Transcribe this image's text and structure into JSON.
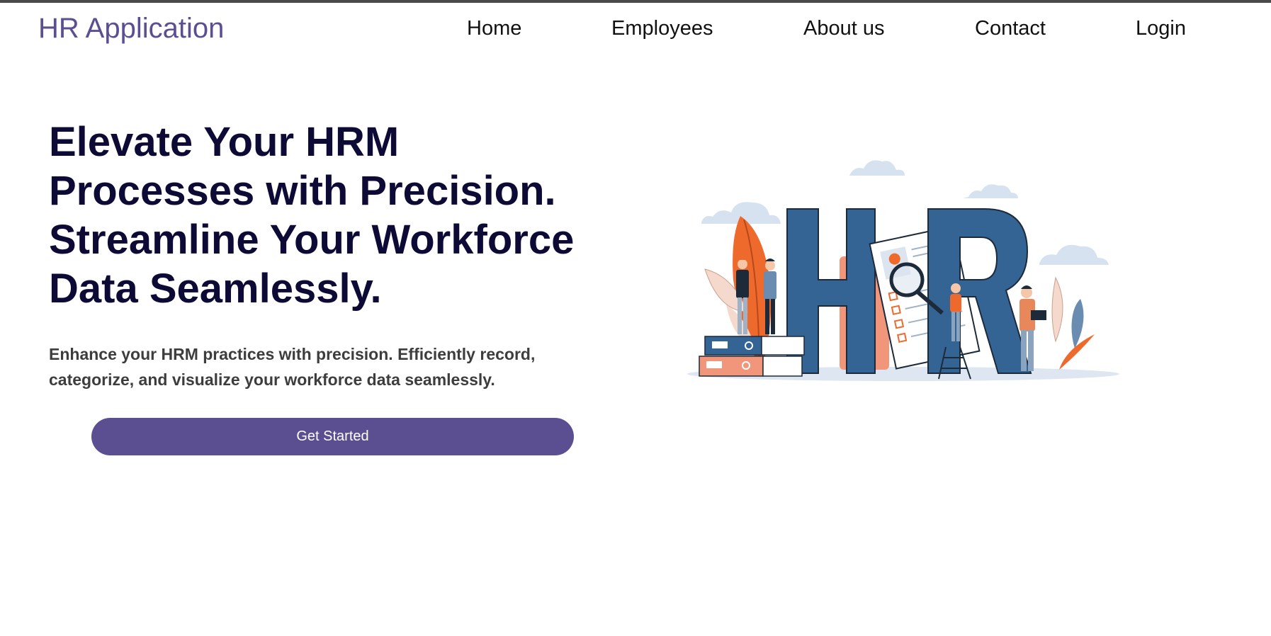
{
  "header": {
    "brand": "HR Application",
    "nav": [
      {
        "label": "Home"
      },
      {
        "label": "Employees"
      },
      {
        "label": "About us"
      },
      {
        "label": "Contact"
      },
      {
        "label": "Login"
      }
    ]
  },
  "hero": {
    "title_lines": [
      "Elevate Your HRM",
      "Processes with Precision.",
      "Streamline Your Workforce",
      "Data Seamlessly."
    ],
    "subtitle_lines": [
      "Enhance your HRM practices with precision. Efficiently record,",
      "categorize, and visualize your workforce data seamlessly."
    ],
    "cta_label": "Get Started"
  },
  "colors": {
    "brand": "#5b4e91",
    "title": "#0d0b35",
    "letters": "#346494",
    "accent_orange": "#ee6a2c",
    "peach": "#f1967a",
    "cloud": "#d6e2ef"
  },
  "illustration": {
    "icon": "hr-illustration"
  }
}
